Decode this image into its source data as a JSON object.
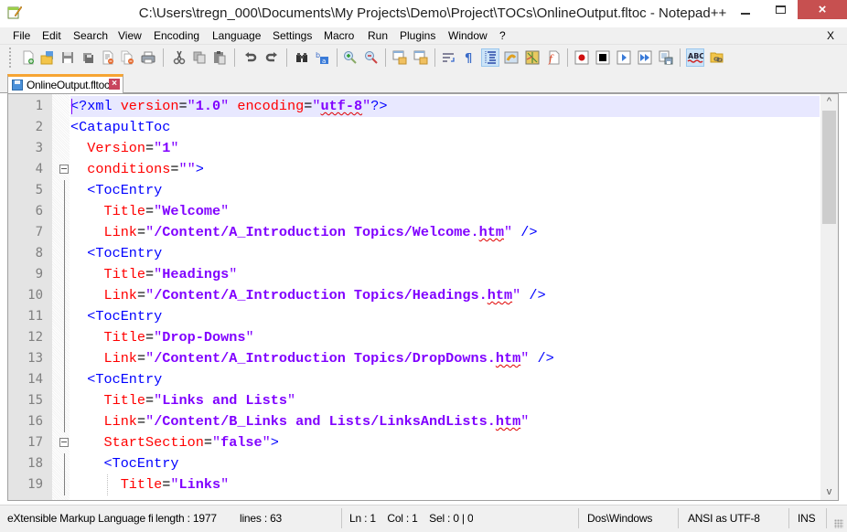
{
  "window": {
    "title": "C:\\Users\\tregn_000\\Documents\\My Projects\\Demo\\Project\\TOCs\\OnlineOutput.fltoc - Notepad++",
    "minimize": "minimize",
    "maximize": "maximize",
    "close": "×"
  },
  "menu": {
    "items": [
      "File",
      "Edit",
      "Search",
      "View",
      "Encoding",
      "Language",
      "Settings",
      "Macro",
      "Run",
      "Plugins",
      "Window",
      "?"
    ],
    "close_doc": "X"
  },
  "toolbar": {
    "buttons": [
      {
        "name": "new-file",
        "icon": "new-file-icon"
      },
      {
        "name": "open-file",
        "icon": "folder-open-icon"
      },
      {
        "name": "save",
        "icon": "save-icon"
      },
      {
        "name": "save-all",
        "icon": "save-all-icon"
      },
      {
        "name": "close",
        "icon": "close-file-icon"
      },
      {
        "name": "close-all",
        "icon": "close-all-icon"
      },
      {
        "name": "print",
        "icon": "printer-icon"
      },
      {
        "name": "cut",
        "icon": "scissors-icon"
      },
      {
        "name": "copy",
        "icon": "copy-icon"
      },
      {
        "name": "paste",
        "icon": "paste-icon"
      },
      {
        "name": "undo",
        "icon": "undo-icon"
      },
      {
        "name": "redo",
        "icon": "redo-icon"
      },
      {
        "name": "find",
        "icon": "binoculars-icon"
      },
      {
        "name": "replace",
        "icon": "replace-icon"
      },
      {
        "name": "zoom-in",
        "icon": "zoom-in-icon"
      },
      {
        "name": "zoom-out",
        "icon": "zoom-out-icon"
      },
      {
        "name": "sync-vertical",
        "icon": "sync-vertical-icon"
      },
      {
        "name": "sync-horizontal",
        "icon": "sync-horizontal-icon"
      },
      {
        "name": "word-wrap",
        "icon": "word-wrap-icon"
      },
      {
        "name": "show-all-chars",
        "icon": "pilcrow-icon"
      },
      {
        "name": "indent-guide",
        "icon": "indent-guide-icon",
        "active": true
      },
      {
        "name": "user-language",
        "icon": "user-language-icon"
      },
      {
        "name": "document-map",
        "icon": "document-map-icon"
      },
      {
        "name": "function-list",
        "icon": "function-list-icon"
      },
      {
        "name": "record-macro",
        "icon": "record-icon"
      },
      {
        "name": "stop-recording",
        "icon": "stop-icon"
      },
      {
        "name": "playback-macro",
        "icon": "play-icon"
      },
      {
        "name": "run-macro-multiple",
        "icon": "fast-forward-icon"
      },
      {
        "name": "save-macro",
        "icon": "save-macro-icon"
      },
      {
        "name": "spell-check",
        "icon": "spell-check-icon",
        "active": true
      },
      {
        "name": "spell-options",
        "icon": "folder-link-icon"
      }
    ]
  },
  "tabs": [
    {
      "label": "OnlineOutput.fltoc",
      "active": true,
      "close": "×"
    }
  ],
  "editor": {
    "current_line": 1,
    "lines": [
      {
        "n": "1",
        "fold": "",
        "segments": [
          [
            "decl",
            "<?xml "
          ],
          [
            "attr",
            "version"
          ],
          [
            "eq",
            "="
          ],
          [
            "q",
            "\""
          ],
          [
            "val",
            "1.0"
          ],
          [
            "q",
            "\" "
          ],
          [
            "attr",
            "encoding"
          ],
          [
            "eq",
            "="
          ],
          [
            "q",
            "\""
          ],
          [
            "val",
            "utf-8",
            "spell"
          ],
          [
            "q",
            "\""
          ],
          [
            "decl",
            "?>"
          ]
        ]
      },
      {
        "n": "2",
        "fold": "",
        "segments": [
          [
            "tag",
            "<CatapultToc"
          ]
        ]
      },
      {
        "n": "3",
        "fold": "",
        "segments": [
          [
            "sp",
            "  "
          ],
          [
            "attr",
            "Version"
          ],
          [
            "eq",
            "="
          ],
          [
            "q",
            "\""
          ],
          [
            "val",
            "1"
          ],
          [
            "q",
            "\""
          ]
        ]
      },
      {
        "n": "4",
        "fold": "box",
        "segments": [
          [
            "sp",
            "  "
          ],
          [
            "attr",
            "conditions"
          ],
          [
            "eq",
            "="
          ],
          [
            "q",
            "\"\""
          ],
          [
            "tag",
            ">"
          ]
        ]
      },
      {
        "n": "5",
        "fold": "line",
        "segments": [
          [
            "sp",
            "  "
          ],
          [
            "tag",
            "<TocEntry"
          ]
        ]
      },
      {
        "n": "6",
        "fold": "line",
        "segments": [
          [
            "sp",
            "    "
          ],
          [
            "attr",
            "Title"
          ],
          [
            "eq",
            "="
          ],
          [
            "q",
            "\""
          ],
          [
            "val",
            "Welcome"
          ],
          [
            "q",
            "\""
          ]
        ]
      },
      {
        "n": "7",
        "fold": "line",
        "segments": [
          [
            "sp",
            "    "
          ],
          [
            "attr",
            "Link"
          ],
          [
            "eq",
            "="
          ],
          [
            "q",
            "\""
          ],
          [
            "val",
            "/Content/A_Introduction Topics/Welcome."
          ],
          [
            "val",
            "htm",
            "spell"
          ],
          [
            "q",
            "\" "
          ],
          [
            "tag",
            "/>"
          ]
        ]
      },
      {
        "n": "8",
        "fold": "line",
        "segments": [
          [
            "sp",
            "  "
          ],
          [
            "tag",
            "<TocEntry"
          ]
        ]
      },
      {
        "n": "9",
        "fold": "line",
        "segments": [
          [
            "sp",
            "    "
          ],
          [
            "attr",
            "Title"
          ],
          [
            "eq",
            "="
          ],
          [
            "q",
            "\""
          ],
          [
            "val",
            "Headings"
          ],
          [
            "q",
            "\""
          ]
        ]
      },
      {
        "n": "10",
        "fold": "line",
        "segments": [
          [
            "sp",
            "    "
          ],
          [
            "attr",
            "Link"
          ],
          [
            "eq",
            "="
          ],
          [
            "q",
            "\""
          ],
          [
            "val",
            "/Content/A_Introduction Topics/Headings."
          ],
          [
            "val",
            "htm",
            "spell"
          ],
          [
            "q",
            "\" "
          ],
          [
            "tag",
            "/>"
          ]
        ]
      },
      {
        "n": "11",
        "fold": "line",
        "segments": [
          [
            "sp",
            "  "
          ],
          [
            "tag",
            "<TocEntry"
          ]
        ]
      },
      {
        "n": "12",
        "fold": "line",
        "segments": [
          [
            "sp",
            "    "
          ],
          [
            "attr",
            "Title"
          ],
          [
            "eq",
            "="
          ],
          [
            "q",
            "\""
          ],
          [
            "val",
            "Drop-Downs"
          ],
          [
            "q",
            "\""
          ]
        ]
      },
      {
        "n": "13",
        "fold": "line",
        "segments": [
          [
            "sp",
            "    "
          ],
          [
            "attr",
            "Link"
          ],
          [
            "eq",
            "="
          ],
          [
            "q",
            "\""
          ],
          [
            "val",
            "/Content/A_Introduction Topics/DropDowns."
          ],
          [
            "val",
            "htm",
            "spell"
          ],
          [
            "q",
            "\" "
          ],
          [
            "tag",
            "/>"
          ]
        ]
      },
      {
        "n": "14",
        "fold": "line",
        "segments": [
          [
            "sp",
            "  "
          ],
          [
            "tag",
            "<TocEntry"
          ]
        ]
      },
      {
        "n": "15",
        "fold": "line",
        "segments": [
          [
            "sp",
            "    "
          ],
          [
            "attr",
            "Title"
          ],
          [
            "eq",
            "="
          ],
          [
            "q",
            "\""
          ],
          [
            "val",
            "Links and Lists"
          ],
          [
            "q",
            "\""
          ]
        ]
      },
      {
        "n": "16",
        "fold": "line",
        "segments": [
          [
            "sp",
            "    "
          ],
          [
            "attr",
            "Link"
          ],
          [
            "eq",
            "="
          ],
          [
            "q",
            "\""
          ],
          [
            "val",
            "/Content/B_Links and Lists/LinksAndLists."
          ],
          [
            "val",
            "htm",
            "spell"
          ],
          [
            "q",
            "\""
          ]
        ]
      },
      {
        "n": "17",
        "fold": "box",
        "segments": [
          [
            "sp",
            "    "
          ],
          [
            "attr",
            "StartSection"
          ],
          [
            "eq",
            "="
          ],
          [
            "q",
            "\""
          ],
          [
            "val",
            "false"
          ],
          [
            "q",
            "\""
          ],
          [
            "tag",
            ">"
          ]
        ]
      },
      {
        "n": "18",
        "fold": "line",
        "segments": [
          [
            "sp",
            "    "
          ],
          [
            "tag",
            "<TocEntry"
          ]
        ]
      },
      {
        "n": "19",
        "fold": "line",
        "segments": [
          [
            "sp",
            "      "
          ],
          [
            "attr",
            "Title"
          ],
          [
            "eq",
            "="
          ],
          [
            "q",
            "\""
          ],
          [
            "val",
            "Links"
          ],
          [
            "q",
            "\""
          ]
        ]
      }
    ]
  },
  "scrollbar": {
    "up": "^",
    "down": "v"
  },
  "status": {
    "file_type": "eXtensible Markup Language file",
    "length": "length : 1977",
    "lines": "lines : 63",
    "position": "Ln : 1    Col : 1    Sel : 0 | 0",
    "eol": "Dos\\Windows",
    "encoding": "ANSI as UTF-8",
    "mode": "INS"
  }
}
